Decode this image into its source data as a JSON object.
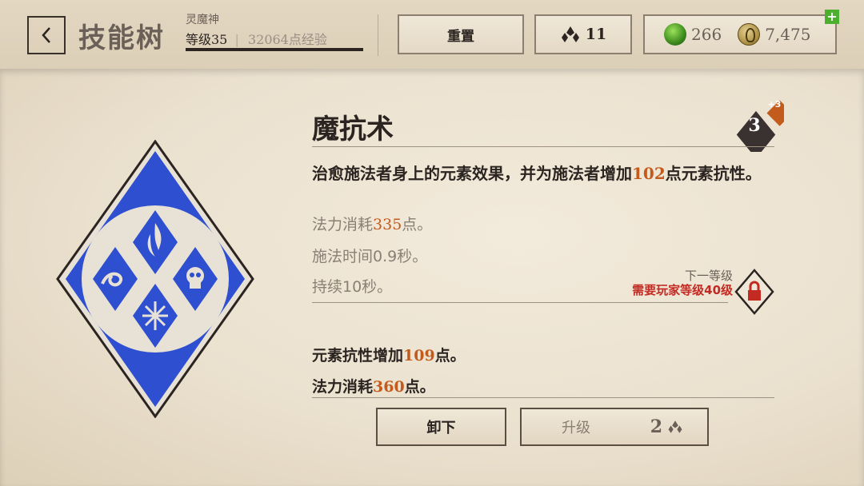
{
  "header": {
    "title": "技能树",
    "class_name": "灵魔神",
    "level_text": "等级35",
    "xp_text": "32064点经验",
    "reset_label": "重置",
    "skill_points": "11",
    "gems": "266",
    "gold": "7,475",
    "add_label": "+"
  },
  "skill": {
    "name": "魔抗术",
    "rank": "3",
    "rank_bonus": "+3",
    "desc_part1": "治愈施法者身上的元素效果，并为施法者增加",
    "desc_num": "102",
    "desc_part2": "点元素抗性。",
    "mana_prefix": "法力消耗",
    "mana_value": "335",
    "mana_suffix": "点。",
    "cast_time": "施法时间0.9秒。",
    "duration": "持续10秒。"
  },
  "next_rank": {
    "label": "下一等级",
    "requirement": "需要玩家等级40级",
    "resist_prefix": "元素抗性增加",
    "resist_value": "109",
    "resist_suffix": "点。",
    "mana_prefix": "法力消耗",
    "mana_value": "360",
    "mana_suffix": "点。"
  },
  "buttons": {
    "unequip": "卸下",
    "upgrade": "升级",
    "upgrade_cost": "2"
  },
  "colors": {
    "accent": "#c25b1c",
    "warning": "#c32a22",
    "emblem_blue": "#2e4fd0"
  },
  "icons": [
    "back-icon",
    "skill-point-icon",
    "gem-icon",
    "gold-coin-icon",
    "plus-icon",
    "skill-emblem",
    "rank-badge",
    "lock-icon"
  ]
}
